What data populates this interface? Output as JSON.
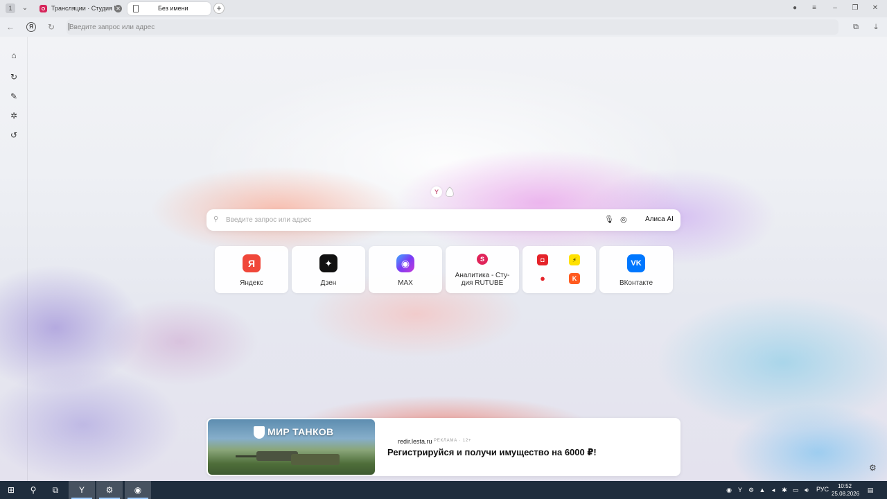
{
  "tabs": {
    "counter": "1",
    "items": [
      {
        "title": "Трансляции · Студия R"
      },
      {
        "title": "Без имени"
      }
    ]
  },
  "addressbar": {
    "placeholder": "Введите запрос или адрес"
  },
  "search": {
    "placeholder": "Введите запрос или адрес",
    "alisa_label": "Алиса AI"
  },
  "tiles": [
    {
      "label": "Яндекс",
      "icon_letter": "Я",
      "color": "#f0473a"
    },
    {
      "label": "Дзен",
      "icon_letter": "✦",
      "color": "#111111"
    },
    {
      "label": "MAX",
      "icon_letter": "◉",
      "color": "#6a4cf5"
    },
    {
      "label": "Аналитика - Сту-дия RUTUBE",
      "label_line1": "Аналитика - Сту-",
      "label_line2": "дия RUTUBE",
      "icon_letter": "S",
      "color": "#e0245a"
    },
    {
      "label": "",
      "group": true
    },
    {
      "label": "ВКонтакте",
      "icon_letter": "VK",
      "color": "#0077ff"
    }
  ],
  "ad": {
    "brand": "МИР ТАНКОВ",
    "domain": "redir.lesta.ru",
    "reklama": "РЕКЛАМА · 12+",
    "headline": "Регистрируйся и получи имущество на 6000 ₽!"
  },
  "taskbar": {
    "lang": "РУС",
    "time": "10:52",
    "date": "25.08.2026"
  },
  "colors": {
    "taskbar": "#1f2d3d",
    "accent": "#f0473a"
  }
}
